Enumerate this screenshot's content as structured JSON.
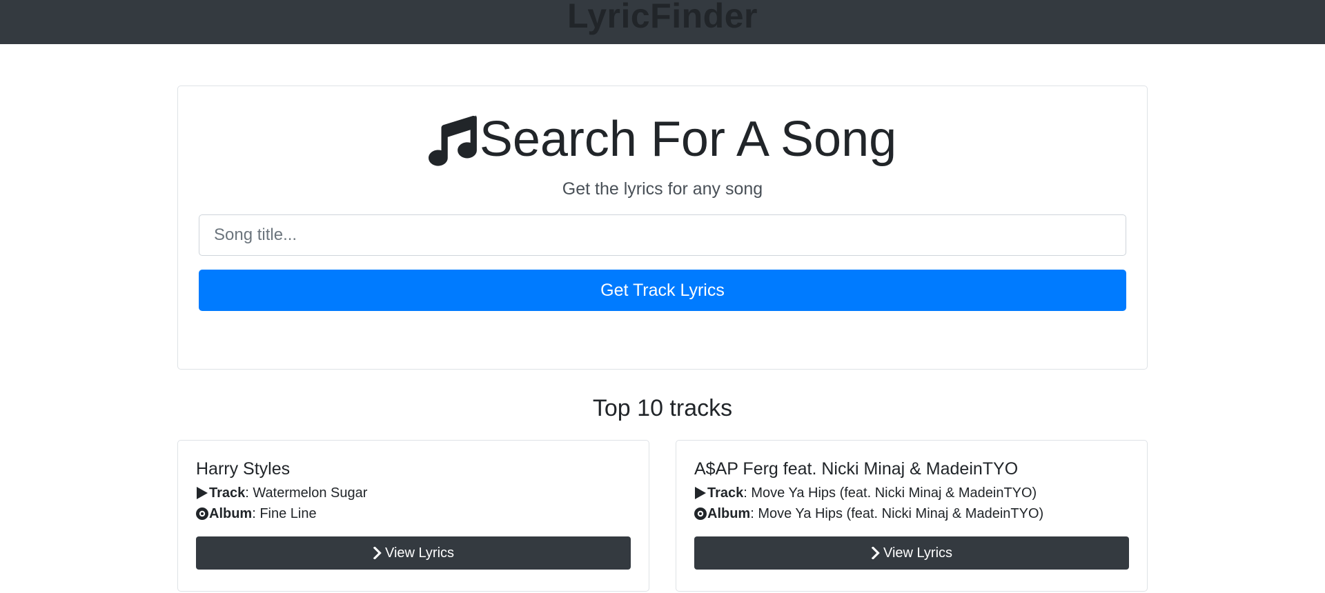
{
  "navbar": {
    "brand": "LyricFinder",
    "bg_color": "#343a40"
  },
  "search": {
    "title": "Search For A Song",
    "title_icon": "music-note-icon",
    "subtitle": "Get the lyrics for any song",
    "placeholder": "Song title...",
    "value": "",
    "button_label": "Get Track Lyrics",
    "button_color": "#007bff"
  },
  "tracks_section": {
    "title": "Top 10 tracks",
    "track_label": "Track",
    "album_label": "Album",
    "track_icon": "play-icon",
    "album_icon": "disc-icon",
    "button_icon": "chevron-right-icon",
    "items": [
      {
        "artist": "Harry Styles",
        "track": ": Watermelon Sugar",
        "album": ": Fine Line",
        "button_label": "View Lyrics"
      },
      {
        "artist": "A$AP Ferg feat. Nicki Minaj & MadeinTYO",
        "track": ": Move Ya Hips (feat. Nicki Minaj & MadeinTYO)",
        "album": ": Move Ya Hips (feat. Nicki Minaj & MadeinTYO)",
        "button_label": "View Lyrics"
      }
    ]
  }
}
